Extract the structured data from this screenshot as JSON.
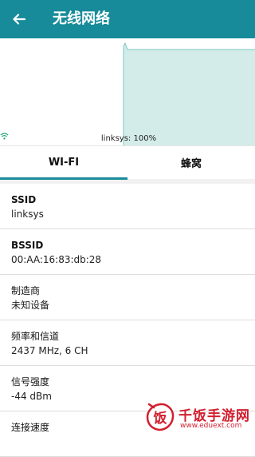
{
  "header": {
    "title": "无线网络",
    "back_icon": "arrow-left-icon",
    "bar_color": "#178b99"
  },
  "graph": {
    "legend": "linksys: 100%",
    "wifi_icon": "wifi-icon",
    "series_color": "#178b99",
    "fill_color": "#d3ece9",
    "signal_percent": 100
  },
  "tabs": {
    "items": [
      {
        "label": "WI-FI",
        "selected": true
      },
      {
        "label": "蜂窝",
        "selected": false
      }
    ]
  },
  "info": {
    "rows": [
      {
        "label": "SSID",
        "value": "linksys"
      },
      {
        "label": "BSSID",
        "value": "00:AA:16:83:db:28"
      },
      {
        "label": "制造商",
        "value": "未知设备"
      },
      {
        "label": "频率和信道",
        "value": "2437 MHz, 6 CH"
      },
      {
        "label": "信号强度",
        "value": "-44 dBm"
      },
      {
        "label": "连接速度",
        "value": ""
      }
    ]
  },
  "watermark": {
    "title": "千饭手游网",
    "url": "www.eduext.com",
    "logo_text": "饭",
    "color": "#d21f2f"
  }
}
